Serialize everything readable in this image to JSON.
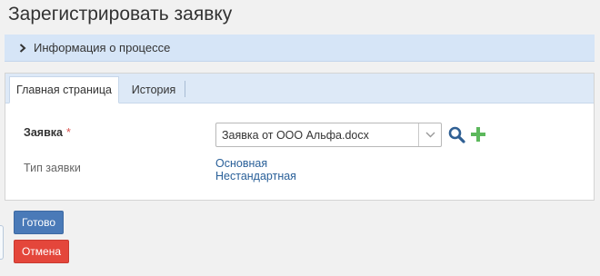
{
  "page": {
    "title": "Зарегистрировать заявку"
  },
  "process_info": {
    "label": "Информация о процессе",
    "icon": "chevron-right-icon"
  },
  "tabs": [
    {
      "label": "Главная страница",
      "active": true
    },
    {
      "label": "История",
      "active": false
    }
  ],
  "form": {
    "request_field": {
      "label": "Заявка",
      "required_mark": "*",
      "value": "Заявка от ООО Альфа.docx",
      "icons": [
        "chevron-down-icon",
        "search-icon",
        "plus-icon"
      ]
    },
    "type_field": {
      "label": "Тип заявки",
      "options": [
        "Основная",
        "Нестандартная"
      ]
    }
  },
  "actions": {
    "ok_label": "Готово",
    "cancel_label": "Отмена"
  },
  "colors": {
    "accent_blue": "#4a7ab8",
    "danger_red": "#e4463b",
    "link": "#2a6099",
    "add_green": "#5cb85c",
    "required": "#d9534f",
    "tab_bar": "#dde9f7"
  }
}
